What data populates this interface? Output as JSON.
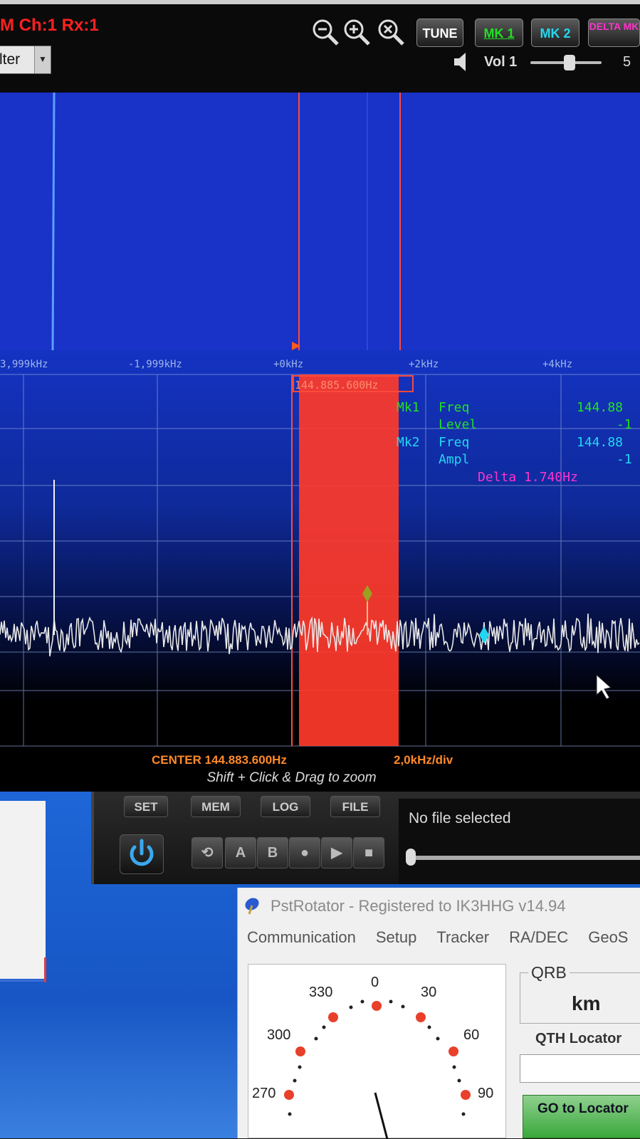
{
  "toolbar": {
    "mode": "M Ch:1 Rx:1",
    "filter_value": "lter",
    "buttons": [
      {
        "label": "TUNE",
        "color": "#ffffff"
      },
      {
        "label": "MK 1",
        "color": "#22e022"
      },
      {
        "label": "MK 2",
        "color": "#22d8f0"
      },
      {
        "label": "DELTA MK",
        "color": "#ff33cc"
      }
    ],
    "volume_label": "Vol 1",
    "volume_value": "5"
  },
  "spectrum": {
    "freq_labels": [
      "3,999kHz",
      "-1,999kHz",
      "+0kHz",
      "+2kHz",
      "+4kHz"
    ],
    "selection_freq": "144.885.600Hz",
    "markers": {
      "mk1_label": "Mk1",
      "mk1_freq_label": "Freq",
      "mk1_freq_value": "144.88",
      "mk1_level_label": "Level",
      "mk1_level_value": "-1",
      "mk2_label": "Mk2",
      "mk2_freq_label": "Freq",
      "mk2_freq_value": "144.88",
      "mk2_ampl_label": "Ampl",
      "mk2_ampl_value": "-1",
      "delta": "Delta 1.740Hz"
    },
    "center": "CENTER 144.883.600Hz",
    "div": "2,0kHz/div",
    "hint": "Shift + Click & Drag to zoom",
    "colors": {
      "mk1": "#22e022",
      "mk2": "#22d8f0",
      "delta": "#ff33cc",
      "selection": "#ff3a2a"
    }
  },
  "controls": {
    "buttons": [
      "SET",
      "MEM",
      "LOG",
      "FILE"
    ],
    "transport": [
      "loop-icon",
      "A",
      "B",
      "record-icon",
      "play-icon",
      "stop-icon"
    ],
    "file_status": "No file selected"
  },
  "pstrotator": {
    "title": "PstRotator - Registered to IK3HHG   v14.94",
    "menu": [
      "Communication",
      "Setup",
      "Tracker",
      "RA/DEC",
      "GeoS"
    ],
    "compass_labels": [
      "0",
      "30",
      "60",
      "90",
      "270",
      "300",
      "330"
    ],
    "qrb_label": "QRB",
    "qrb_unit": "km",
    "qth_label": "QTH Locator",
    "goto_label": "GO to Locator"
  }
}
